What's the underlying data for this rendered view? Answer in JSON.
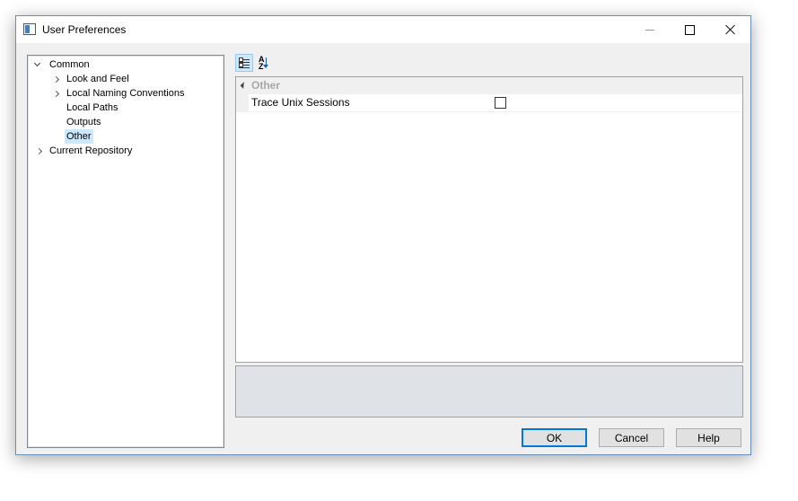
{
  "window": {
    "title": "User Preferences",
    "icon": "window-app-icon",
    "controls": [
      "minimize-icon",
      "maximize-icon",
      "close-icon"
    ]
  },
  "tree": {
    "items": [
      {
        "label": "Common",
        "state": "expanded"
      },
      {
        "label": "Look and Feel",
        "state": "collapsed"
      },
      {
        "label": "Local Naming Conventions",
        "state": "collapsed"
      },
      {
        "label": "Local Paths"
      },
      {
        "label": "Outputs"
      },
      {
        "label": "Other",
        "selected": true
      },
      {
        "label": "Current Repository",
        "state": "collapsed"
      }
    ]
  },
  "toolbar": {
    "categorized_icon": "categorized-view-icon",
    "alphabetical_icon": "alphabetical-sort-icon",
    "alpha_glyph": "A\nZ"
  },
  "property_grid": {
    "category": "Other",
    "properties": [
      {
        "name": "Trace Unix Sessions",
        "checked": false
      }
    ]
  },
  "buttons": {
    "ok": "OK",
    "cancel": "Cancel",
    "help": "Help"
  },
  "colors": {
    "selection": "#cce8ff",
    "accent": "#0078d7",
    "description_panel": "#dfe3e8"
  }
}
